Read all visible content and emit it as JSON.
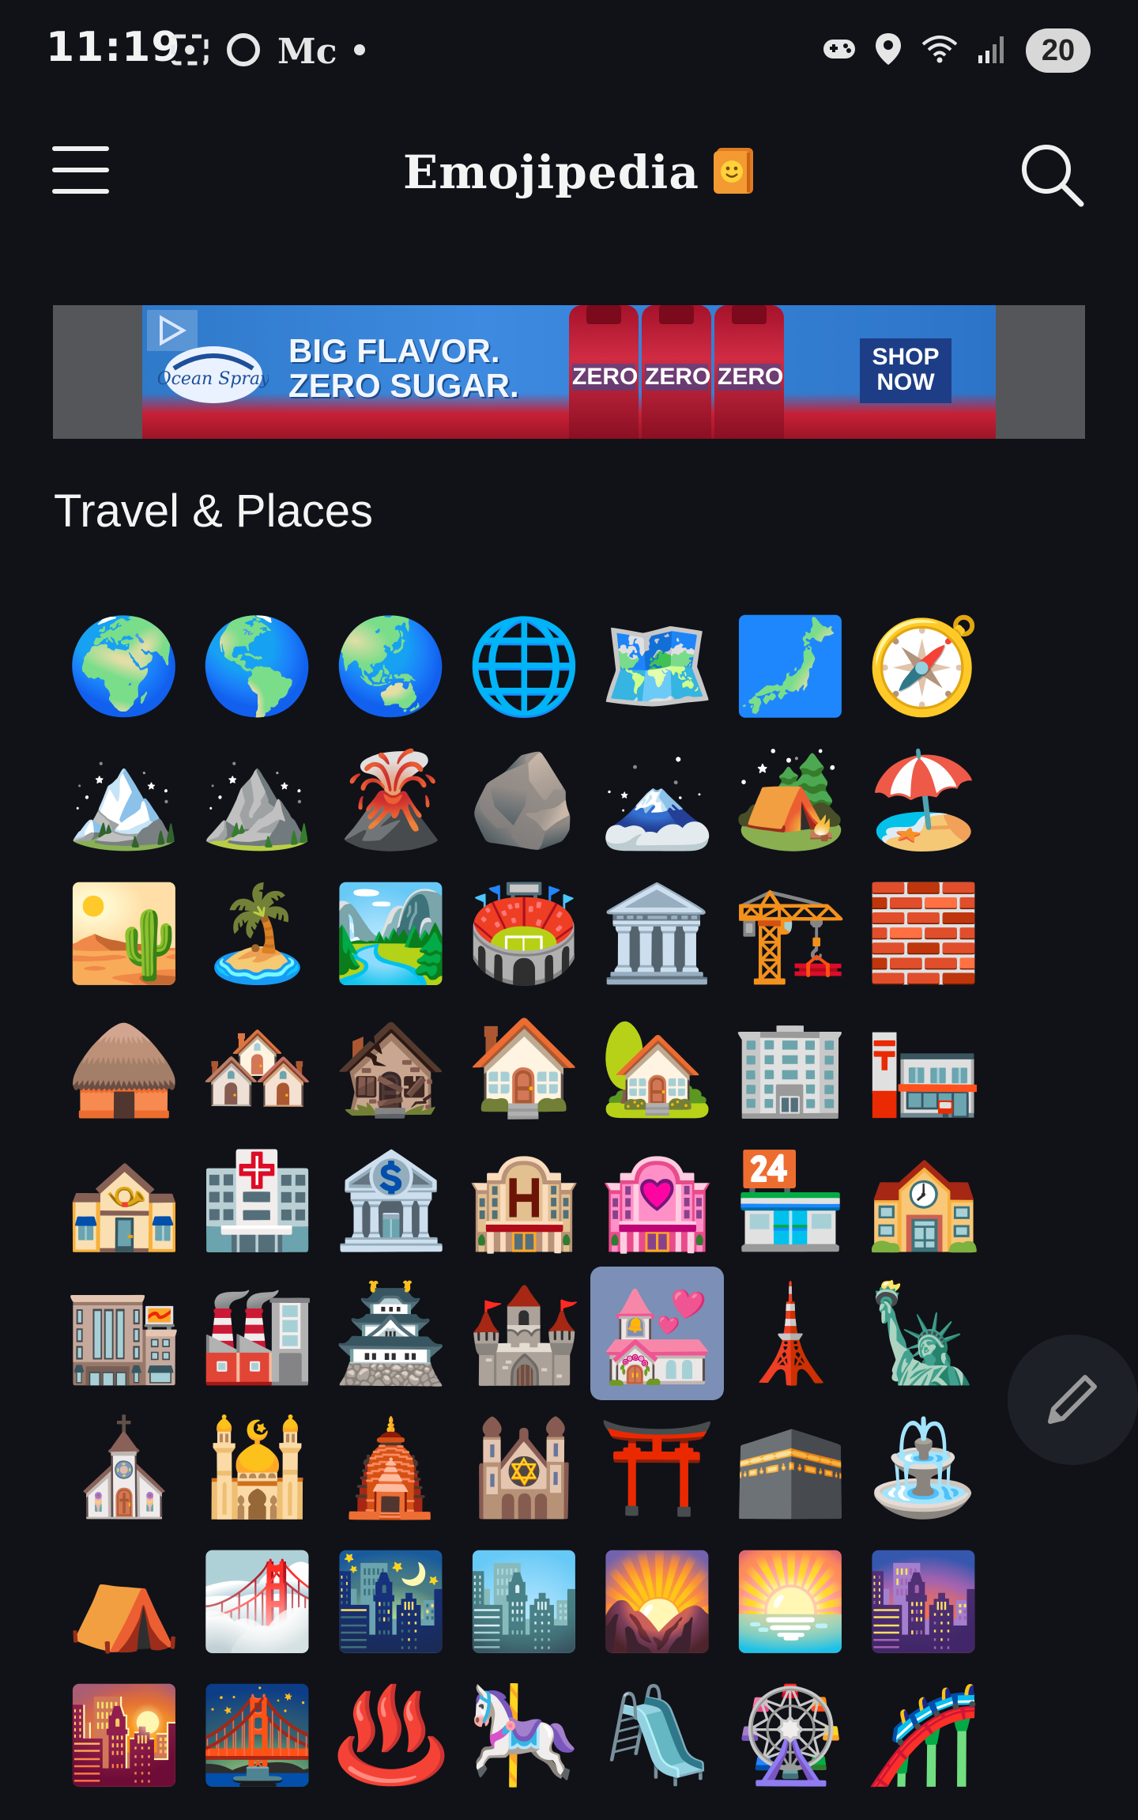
{
  "status_bar": {
    "time": "11:19",
    "left_text": "Mc",
    "battery_level": "20"
  },
  "header": {
    "logo_text": "Emojipedia",
    "menu_icon": "hamburger-icon",
    "search_icon": "search-icon"
  },
  "ad": {
    "brand": "Ocean Spray",
    "headline_line1": "BIG FLAVOR.",
    "headline_line2": "ZERO SUGAR.",
    "bottle_label": "ZERO",
    "cta_line1": "SHOP",
    "cta_line2": "NOW"
  },
  "section": {
    "title": "Travel & Places"
  },
  "emoji_rows": [
    [
      "🌍",
      "🌎",
      "🌏",
      "🌐",
      "🗺️",
      "🗾",
      "🧭"
    ],
    [
      "🏔️",
      "⛰️",
      "🌋",
      "🪨",
      "🗻",
      "🏕️",
      "🏖️"
    ],
    [
      "🏜️",
      "🏝️",
      "🏞️",
      "🏟️",
      "🏛️",
      "🏗️",
      "🧱"
    ],
    [
      "🛖",
      "🏘️",
      "🏚️",
      "🏠",
      "🏡",
      "🏢",
      "🏣"
    ],
    [
      "🏤",
      "🏥",
      "🏦",
      "🏨",
      "🏩",
      "🏪",
      "🏫"
    ],
    [
      "🏬",
      "🏭",
      "🏯",
      "🏰",
      "💒",
      "🗼",
      "🗽"
    ],
    [
      "⛪",
      "🕌",
      "🛕",
      "🕍",
      "⛩️",
      "🕋",
      "⛲"
    ],
    [
      "⛺",
      "🌁",
      "🌃",
      "🏙️",
      "🌄",
      "🌅",
      "🌆"
    ],
    [
      "🌇",
      "🌉",
      "♨️",
      "🎠",
      "🛝",
      "🎡",
      "🎢"
    ]
  ],
  "selected_emoji": "💒",
  "fab": {
    "icon": "pencil-icon"
  },
  "colors": {
    "background": "#101218",
    "selected_highlight": "#7c8fb6",
    "ad_background": "#55565a"
  }
}
